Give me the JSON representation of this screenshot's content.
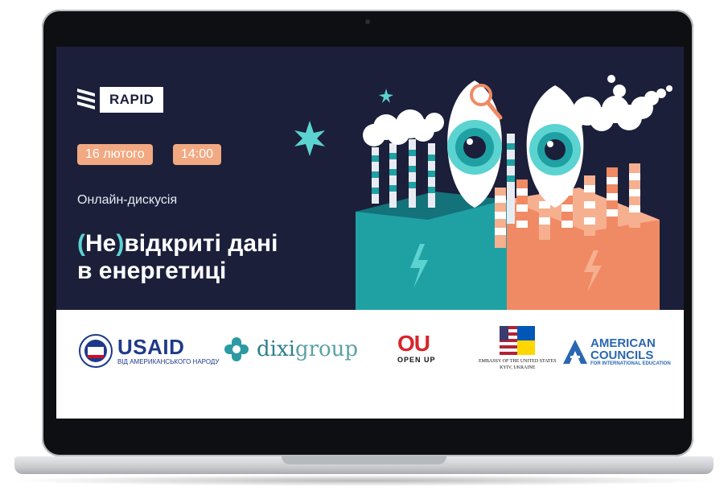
{
  "hero": {
    "brand": "RAPID",
    "date": "16 лютого",
    "time": "14:00",
    "event_type": "Онлайн-дискусія",
    "title_accent_open": "(",
    "title_accent_word": "Не",
    "title_accent_close": ")",
    "title_line1_rest": "відкриті дані",
    "title_line2": "в енергетиці"
  },
  "sponsors": {
    "usaid": {
      "name": "USAID",
      "tagline": "ВІД АМЕРИКАНСЬКОГО НАРОДУ"
    },
    "dixi": {
      "name_a": "dixi",
      "name_b": "group"
    },
    "openup": {
      "mark": "OU",
      "text": "OPEN UP"
    },
    "embassy": {
      "line1": "EMBASSY OF THE UNITED STATES",
      "line2": "KYIV, UKRAINE"
    },
    "american_councils": {
      "line1": "AMERICAN",
      "line2": "COUNCILS",
      "line3": "FOR INTERNATIONAL EDUCATION"
    }
  },
  "colors": {
    "hero_bg": "#1b1f3a",
    "accent_teal": "#5bd3d1",
    "accent_peach": "#f2a982"
  }
}
